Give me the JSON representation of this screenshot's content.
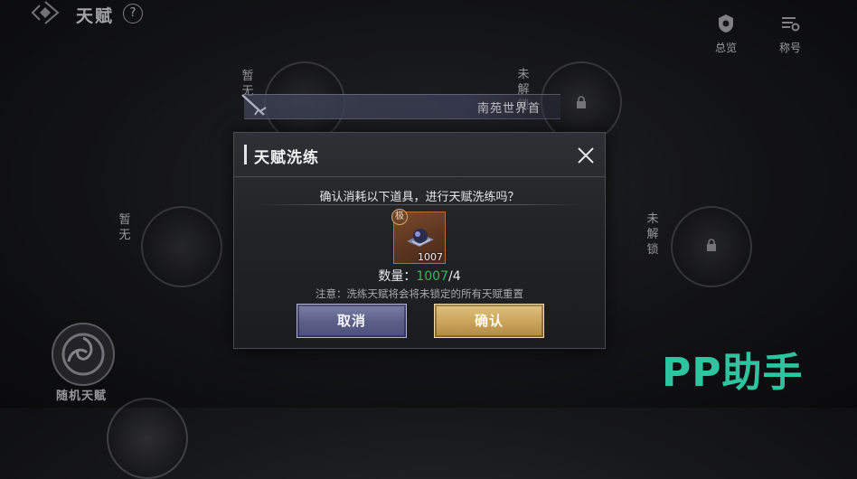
{
  "header": {
    "title": "天赋",
    "help_label": "?",
    "overview_label": "总览",
    "titles_label": "称号"
  },
  "background": {
    "slot_empty_1": [
      "暂",
      "无"
    ],
    "slot_empty_2": [
      "暂",
      "无"
    ],
    "slot_locked_1": [
      "未",
      "解",
      "锁"
    ],
    "slot_locked_2": [
      "未",
      "解",
      "锁"
    ],
    "banner_text": "南苑世界首",
    "random_talent_label": "随机天赋"
  },
  "dialog": {
    "title": "天赋洗练",
    "prompt": "确认消耗以下道具，进行天赋洗练吗？",
    "item": {
      "grade_badge": "极",
      "count": "1007"
    },
    "quantity_label": "数量：",
    "quantity_have": "1007",
    "quantity_need": "/4",
    "note": "注意：洗练天赋将会将未锁定的所有天赋重置",
    "cancel_label": "取消",
    "confirm_label": "确认"
  },
  "watermark": "PP助手",
  "colors": {
    "quantity_green": "#3bb55a",
    "confirm_gold": "#c9a35a",
    "cancel_blue": "#5b5f88",
    "watermark_teal": "#2ec4a0"
  }
}
